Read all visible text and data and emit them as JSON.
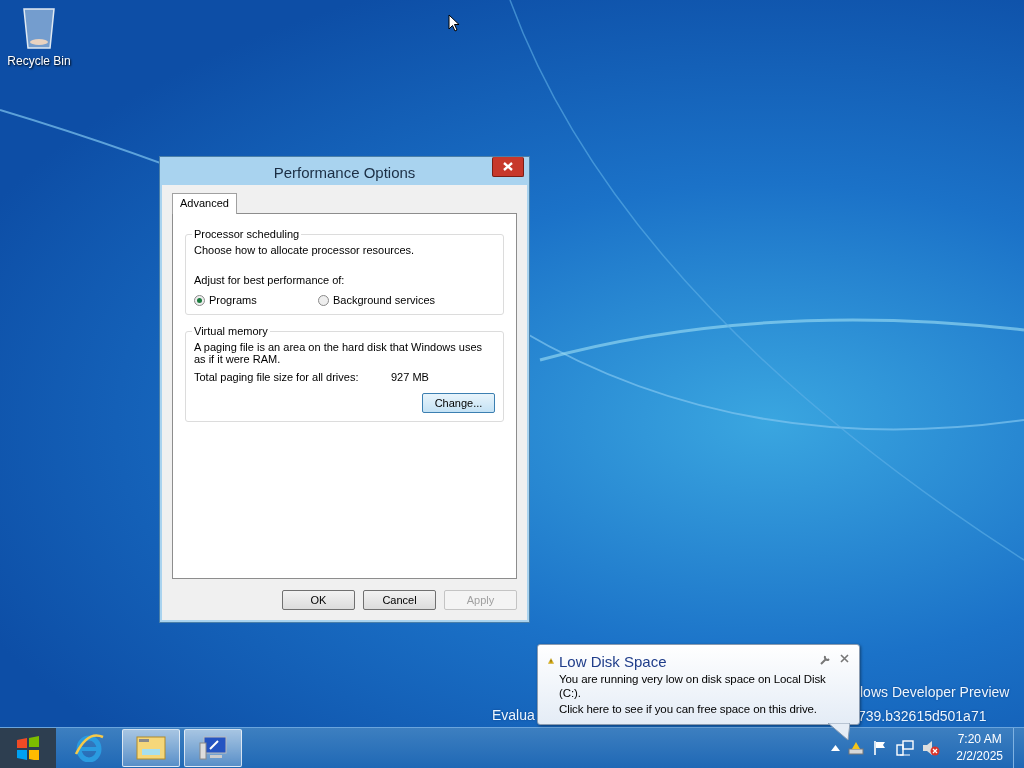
{
  "desktop": {
    "icons": [
      {
        "label": "Recycle Bin"
      }
    ],
    "build_text": [
      "lows Developer Preview",
      "Evalua",
      "739.b32615d501a71"
    ]
  },
  "dialog": {
    "title": "Performance Options",
    "tabs": [
      {
        "label": "Advanced",
        "selected": true
      }
    ],
    "processor_scheduling": {
      "title": "Processor scheduling",
      "description": "Choose how to allocate processor resources.",
      "prompt": "Adjust for best performance of:",
      "options": [
        {
          "label": "Programs",
          "selected": true
        },
        {
          "label": "Background services",
          "selected": false
        }
      ]
    },
    "virtual_memory": {
      "title": "Virtual memory",
      "description": "A paging file is an area on the hard disk that Windows uses as if it were RAM.",
      "total_label": "Total paging file size for all drives:",
      "total_value": "927 MB",
      "button": "Change..."
    },
    "buttons": [
      {
        "label": "OK",
        "disabled": false
      },
      {
        "label": "Cancel",
        "disabled": false
      },
      {
        "label": "Apply",
        "disabled": true
      }
    ]
  },
  "notification": {
    "title": "Low Disk Space",
    "lines": [
      "You are running very low on disk space on Local Disk (C:).",
      "Click here to see if you can free space on this drive."
    ]
  },
  "taskbar": {
    "apps": [
      {
        "kind": "browser",
        "running": false
      },
      {
        "kind": "explorer",
        "running": true
      },
      {
        "kind": "system",
        "running": true
      }
    ],
    "clock": {
      "time": "7:20 AM",
      "date": "2/2/2025"
    }
  }
}
